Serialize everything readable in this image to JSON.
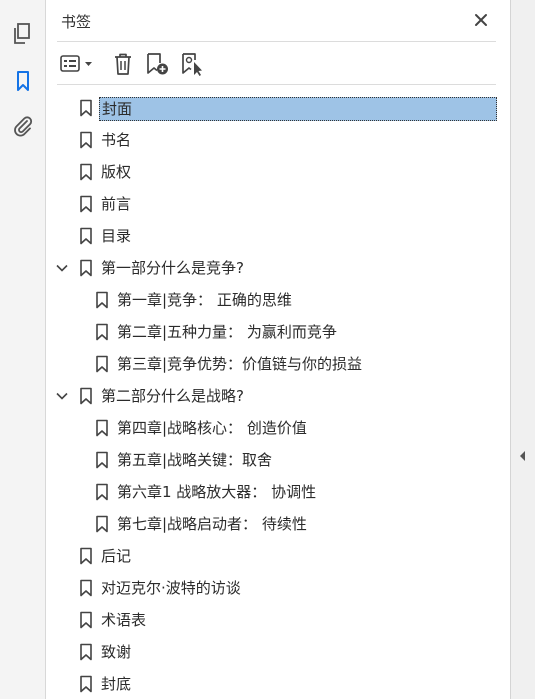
{
  "panel": {
    "title": "书签"
  },
  "rail": {
    "icons": [
      "pages-icon",
      "bookmarks-icon",
      "attachments-icon"
    ],
    "active": "bookmarks-icon",
    "accent": "#1473e6"
  },
  "toolbar": {
    "icons": [
      "options-menu-icon",
      "delete-bookmark-icon",
      "new-bookmark-icon",
      "bookmark-from-selection-icon"
    ]
  },
  "colors": {
    "selection": "#9ec3e6",
    "rail_bg": "#f4f4f4",
    "text": "#2b2b2b"
  },
  "bookmarks": [
    {
      "label": "封面",
      "level": 0,
      "selected": true
    },
    {
      "label": "书名",
      "level": 0
    },
    {
      "label": "版权",
      "level": 0
    },
    {
      "label": "前言",
      "level": 0
    },
    {
      "label": "目录",
      "level": 0
    },
    {
      "label": "第一部分什么是竞争?",
      "level": 0,
      "expanded": true
    },
    {
      "label": "第一章|竞争： 正确的思维",
      "level": 1
    },
    {
      "label": "第二章|五种力量： 为赢利而竞争",
      "level": 1
    },
    {
      "label": "第三章|竞争优势：价值链与你的损益",
      "level": 1
    },
    {
      "label": "第二部分什么是战略?",
      "level": 0,
      "expanded": true
    },
    {
      "label": "第四章|战略核心： 创造价值",
      "level": 1
    },
    {
      "label": "第五章|战略关键：取舍",
      "level": 1
    },
    {
      "label": "第六章1 战略放大器： 协调性",
      "level": 1
    },
    {
      "label": "第七章|战略启动者： 待续性",
      "level": 1
    },
    {
      "label": "后记",
      "level": 0
    },
    {
      "label": "对迈克尔·波特的访谈",
      "level": 0
    },
    {
      "label": "术语表",
      "level": 0
    },
    {
      "label": "致谢",
      "level": 0
    },
    {
      "label": "封底",
      "level": 0
    }
  ]
}
